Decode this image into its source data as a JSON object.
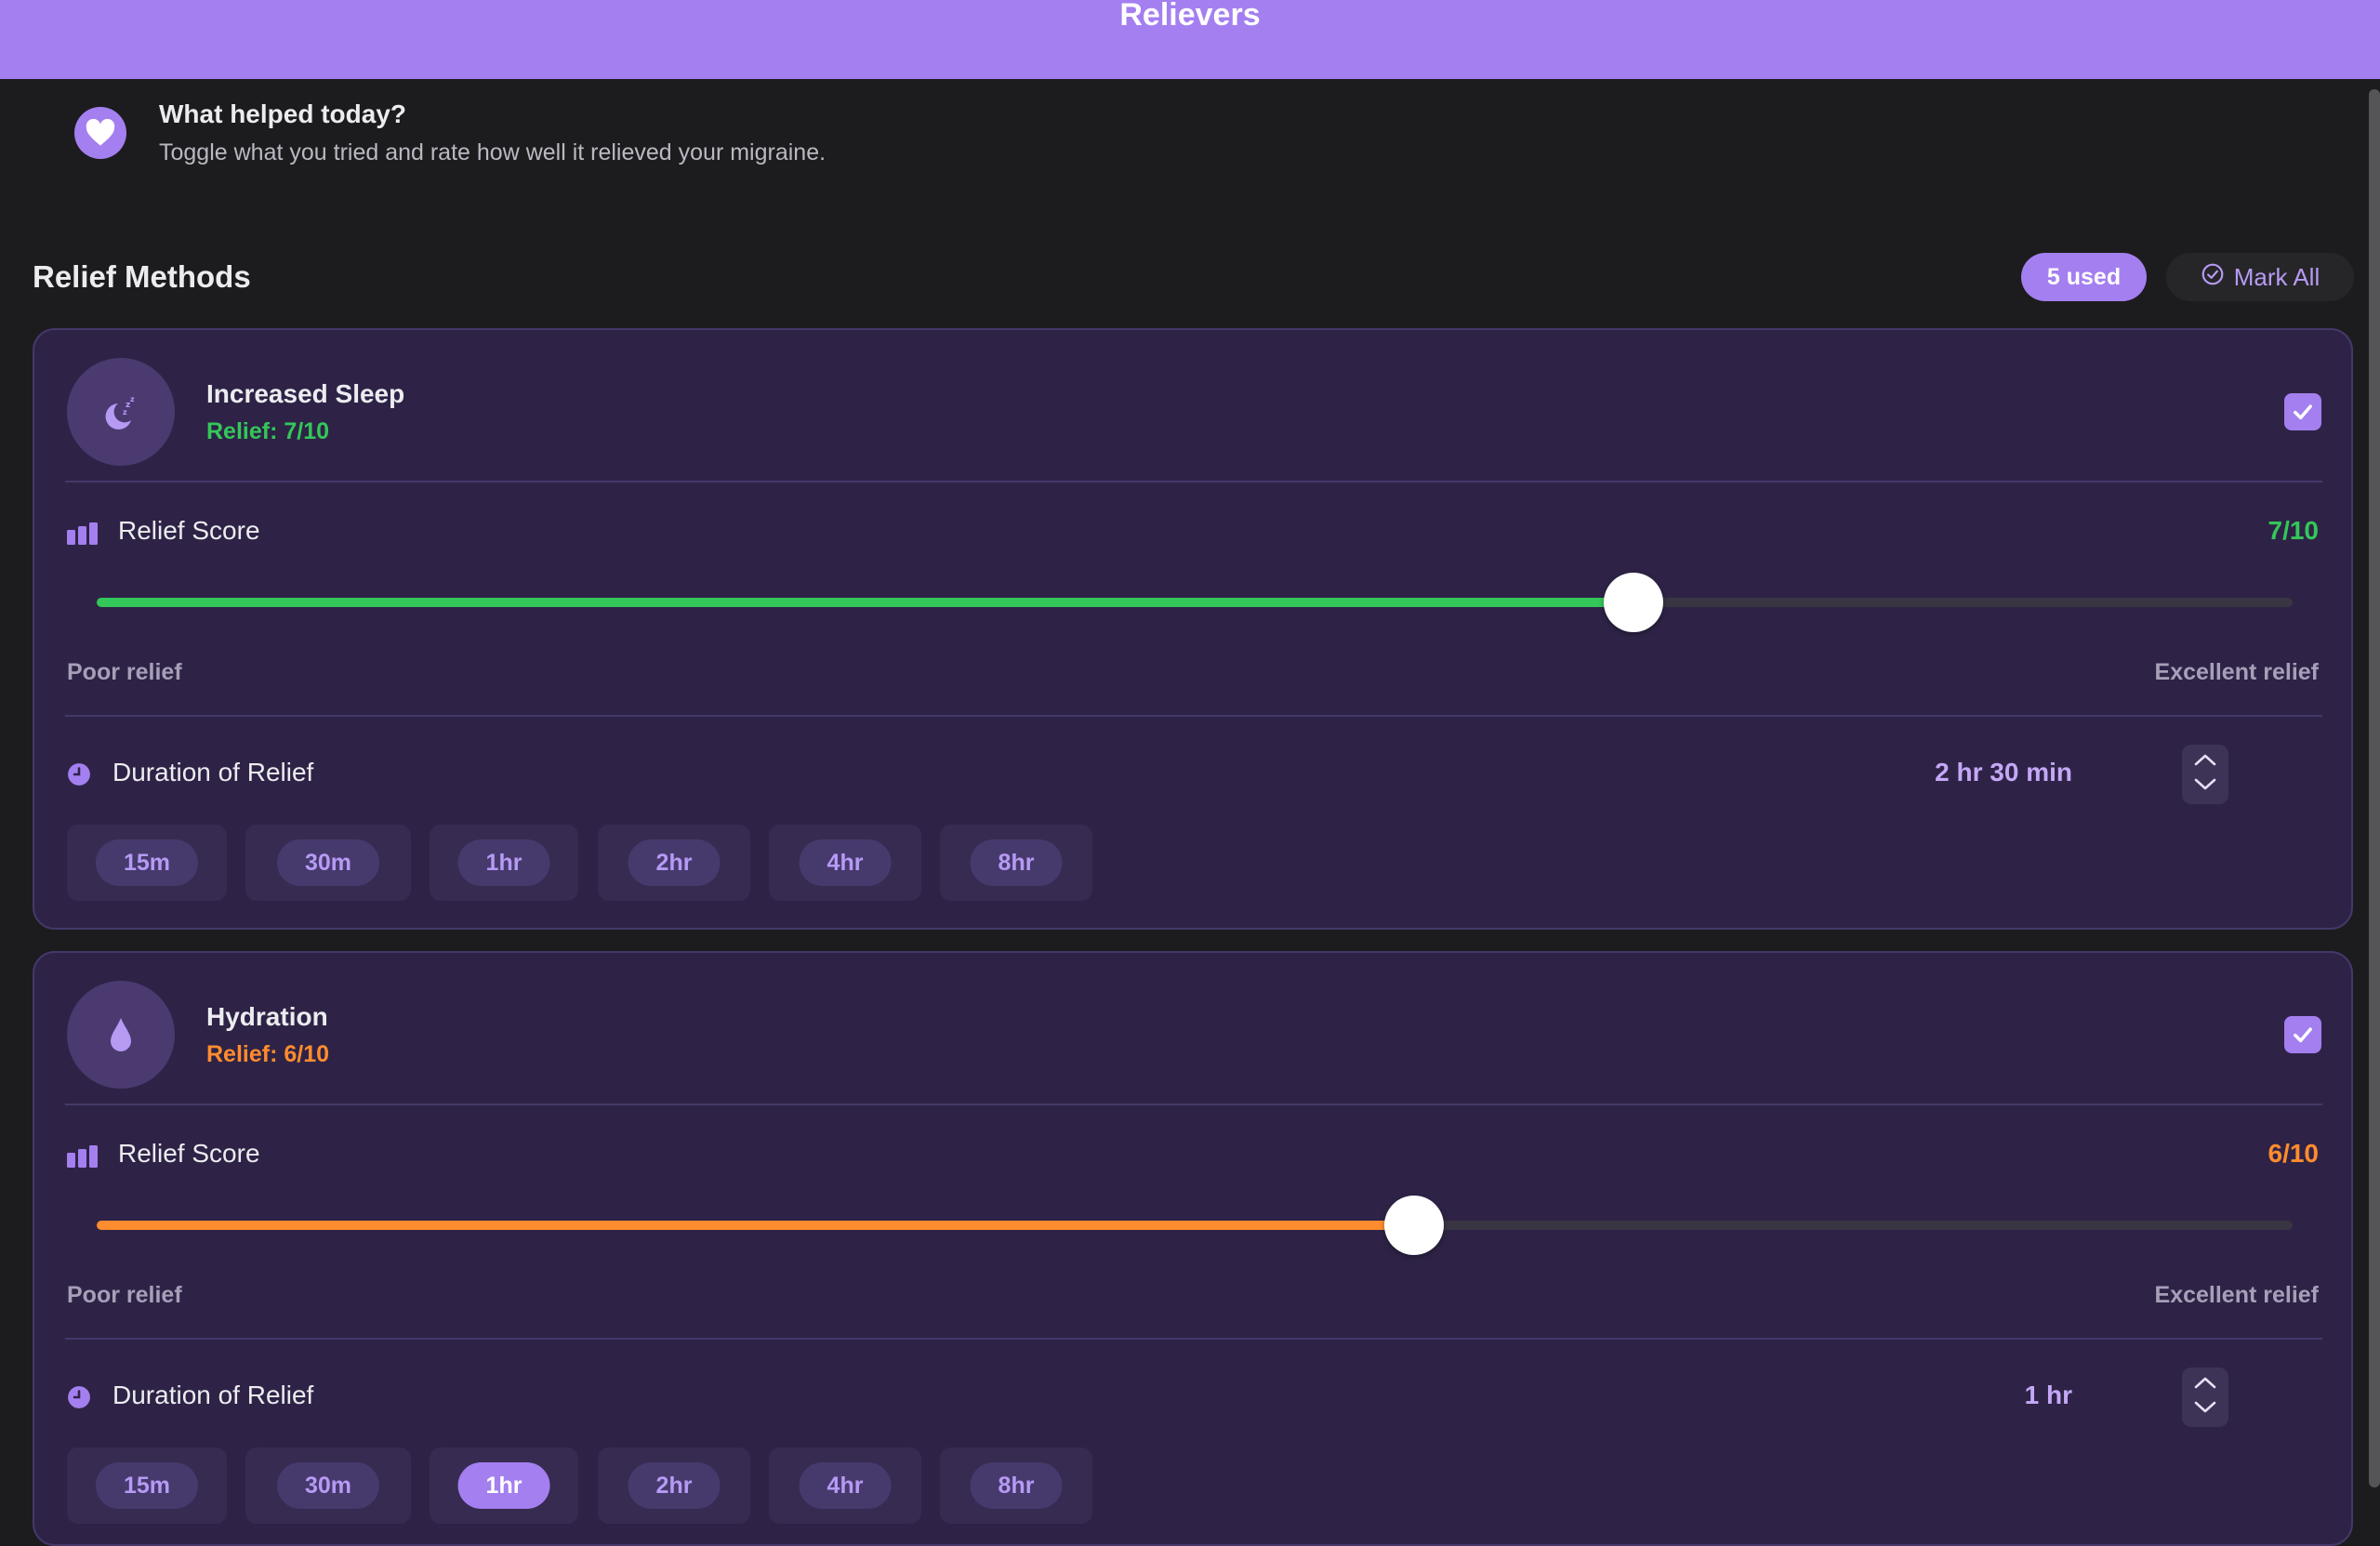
{
  "nav": {
    "title": "Relievers"
  },
  "intro": {
    "icon": "heart-icon",
    "title": "What helped today?",
    "subtitle": "Toggle what you tried and rate how well it relieved your migraine."
  },
  "section": {
    "title": "Relief Methods",
    "used_badge": "5 used",
    "mark_all_label": "Mark All"
  },
  "colors": {
    "accent": "#a47ff0",
    "good": "#34c759",
    "moderate": "#ff8c2e",
    "card_bg": "#2e2346"
  },
  "labels": {
    "relief_score": "Relief Score",
    "poor": "Poor relief",
    "excellent": "Excellent relief",
    "duration": "Duration of Relief"
  },
  "methods": [
    {
      "name": "Increased Sleep",
      "icon": "moon-sleep-icon",
      "relief_text": "Relief: 7/10",
      "score_text": "7/10",
      "score": 7,
      "score_max": 10,
      "checked": true,
      "duration": "2 hr 30 min",
      "chips": [
        "15m",
        "30m",
        "1hr",
        "2hr",
        "4hr",
        "8hr"
      ],
      "selected_chip": null
    },
    {
      "name": "Hydration",
      "icon": "water-drop-icon",
      "relief_text": "Relief: 6/10",
      "score_text": "6/10",
      "score": 6,
      "score_max": 10,
      "checked": true,
      "duration": "1 hr",
      "chips": [
        "15m",
        "30m",
        "1hr",
        "2hr",
        "4hr",
        "8hr"
      ],
      "selected_chip": "1hr"
    }
  ]
}
